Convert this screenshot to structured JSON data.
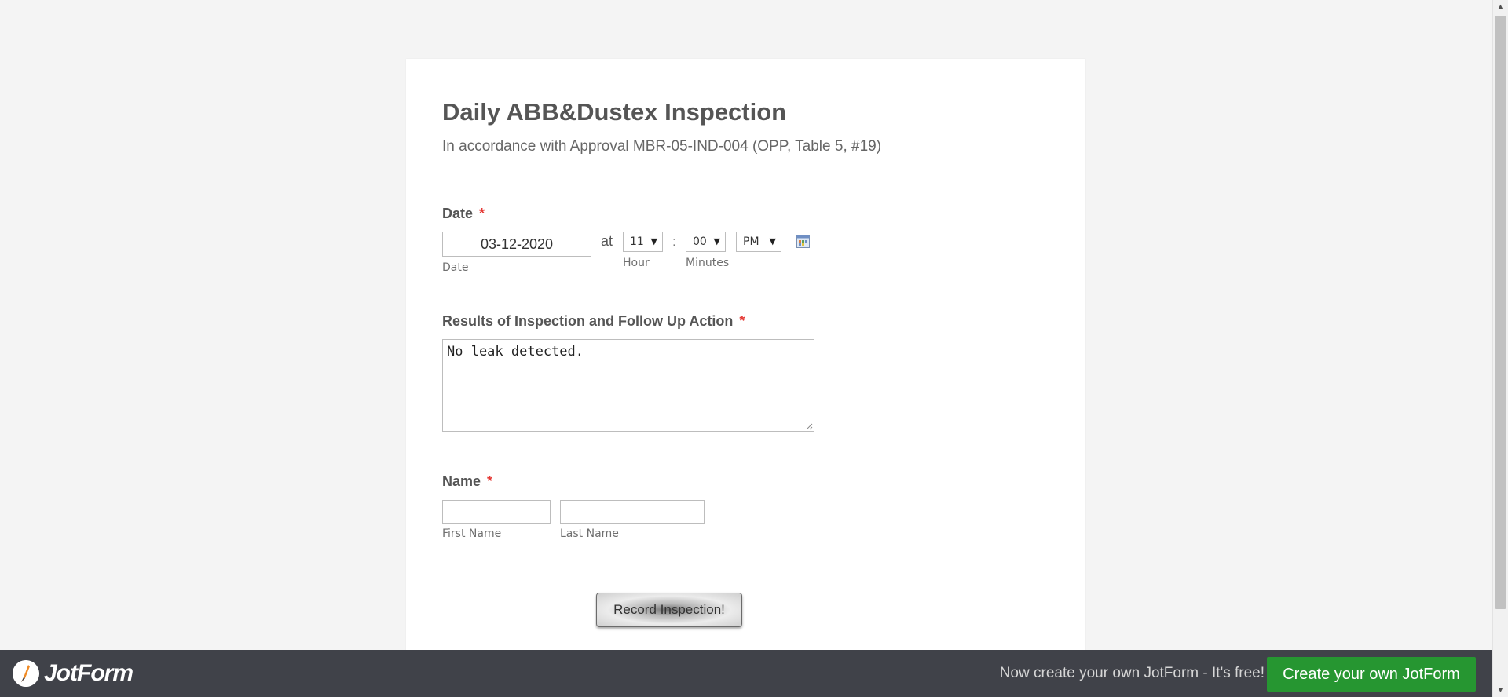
{
  "form": {
    "title": "Daily ABB&Dustex Inspection",
    "subtitle": "In accordance with Approval MBR-05-IND-004 (OPP, Table 5, #19)",
    "required_mark": "*",
    "date_field": {
      "label": "Date",
      "value": "03-12-2020",
      "date_sublabel": "Date",
      "at_text": "at",
      "hour_value": "11",
      "hour_sublabel": "Hour",
      "colon": ":",
      "minute_value": "00",
      "minute_sublabel": "Minutes",
      "ampm_value": "PM",
      "calendar_icon": "calendar-icon"
    },
    "results_field": {
      "label": "Results of Inspection and Follow Up Action",
      "value": "No leak detected."
    },
    "name_field": {
      "label": "Name",
      "first_value": "",
      "first_sublabel": "First Name",
      "last_value": "",
      "last_sublabel": "Last Name"
    },
    "submit_label": "Record Inspection!"
  },
  "footer": {
    "logo_text": "JotForm",
    "promo_text": "Now create your own JotForm - It's free!",
    "cta_label": "Create your own JotForm",
    "cta_color": "#269631",
    "background_color": "#404249"
  },
  "colors": {
    "page_background": "#f4f4f4",
    "required": "#e53935"
  }
}
